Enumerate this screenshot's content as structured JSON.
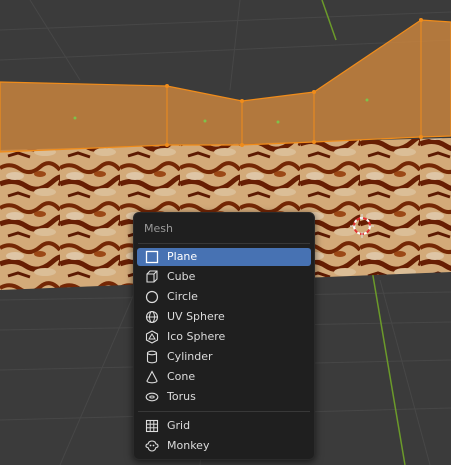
{
  "menu": {
    "title": "Mesh",
    "items": [
      {
        "label": "Plane",
        "icon": "plane-icon",
        "active": true
      },
      {
        "label": "Cube",
        "icon": "cube-icon"
      },
      {
        "label": "Circle",
        "icon": "circle-icon"
      },
      {
        "label": "UV Sphere",
        "icon": "uv-sphere-icon"
      },
      {
        "label": "Ico Sphere",
        "icon": "ico-sphere-icon"
      },
      {
        "label": "Cylinder",
        "icon": "cylinder-icon"
      },
      {
        "label": "Cone",
        "icon": "cone-icon"
      },
      {
        "label": "Torus",
        "icon": "torus-icon"
      },
      {
        "label": "Grid",
        "icon": "grid-icon"
      },
      {
        "label": "Monkey",
        "icon": "monkey-icon"
      }
    ]
  },
  "colors": {
    "menu_bg": "#1f1f1f",
    "highlight": "#4772b3",
    "selection_orange": "#f08c1a",
    "viewport_bg": "#3a3a3a"
  }
}
